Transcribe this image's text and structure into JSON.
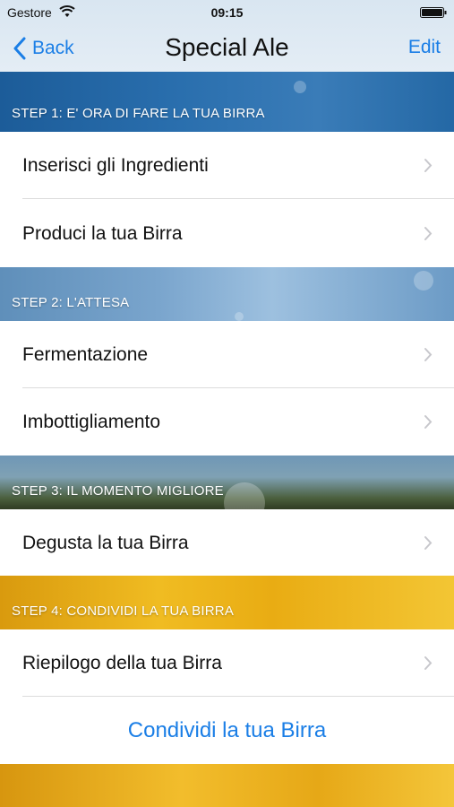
{
  "status_bar": {
    "carrier": "Gestore",
    "time": "09:15"
  },
  "nav": {
    "back_label": "Back",
    "title": "Special Ale",
    "edit_label": "Edit"
  },
  "sections": [
    {
      "header": "STEP 1: E' ORA DI FARE LA TUA BIRRA",
      "items": [
        {
          "label": "Inserisci gli Ingredienti"
        },
        {
          "label": "Produci la tua Birra"
        }
      ]
    },
    {
      "header": "STEP 2: L'ATTESA",
      "items": [
        {
          "label": "Fermentazione"
        },
        {
          "label": "Imbottigliamento"
        }
      ]
    },
    {
      "header": "STEP 3: IL MOMENTO MIGLIORE",
      "items": [
        {
          "label": "Degusta la tua Birra"
        }
      ]
    },
    {
      "header": "STEP 4: CONDIVIDI LA TUA BIRRA",
      "items": [
        {
          "label": "Riepilogo della tua Birra"
        }
      ],
      "action_label": "Condividi la tua Birra"
    }
  ],
  "colors": {
    "accent": "#1a7ee6",
    "chevron": "#c7c7cc",
    "divider": "#dcdcdc"
  }
}
